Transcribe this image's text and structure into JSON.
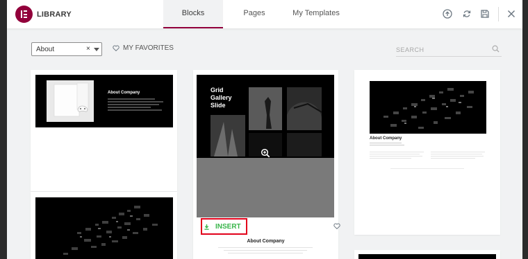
{
  "header": {
    "title": "LIBRARY",
    "tabs": [
      {
        "label": "Blocks",
        "active": true
      },
      {
        "label": "Pages",
        "active": false
      },
      {
        "label": "My Templates",
        "active": false
      }
    ]
  },
  "toolbar": {
    "category_value": "About",
    "clear_symbol": "×",
    "favorites_label": "MY FAVORITES",
    "search_placeholder": "SEARCH"
  },
  "cards": {
    "card1_title": "About Company",
    "card3_title_line1": "Grid",
    "card3_title_line2": "Gallery",
    "card3_title_line3": "Slide",
    "card3_footer_title": "About Company",
    "card4_title": "About Company",
    "insert_label": "INSERT"
  },
  "colors": {
    "brand": "#92003b",
    "insert_green": "#39b54a",
    "highlight_red": "#e2001a"
  },
  "icons": [
    "elementor-logo-icon",
    "upload-icon",
    "sync-icon",
    "save-icon",
    "close-icon",
    "heart-icon",
    "search-icon",
    "zoom-icon",
    "download-icon"
  ]
}
